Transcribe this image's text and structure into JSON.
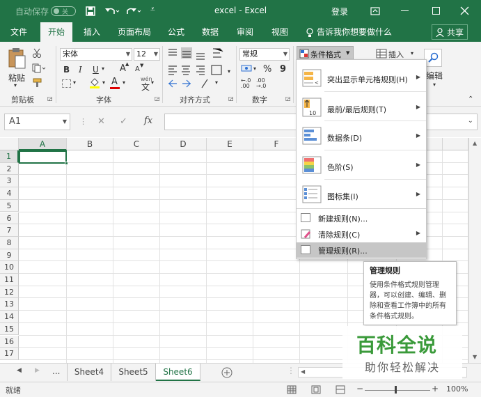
{
  "titlebar": {
    "autosave_label": "自动保存",
    "autosave_state": "关",
    "title": "excel - Excel",
    "login": "登录"
  },
  "tabs": [
    "文件",
    "开始",
    "插入",
    "页面布局",
    "公式",
    "数据",
    "审阅",
    "视图"
  ],
  "tell_me": "告诉我你想要做什么",
  "share": "共享",
  "ribbon": {
    "paste": "粘贴",
    "font_name": "宋体",
    "font_size": "12",
    "bold": "B",
    "italic": "I",
    "underline": "U",
    "grow_font": "A",
    "shrink_font": "A",
    "number_format": "常规",
    "percent": "%",
    "comma": "9",
    "wen": "wén",
    "cond_format": "条件格式",
    "insert": "插入",
    "edit": "编辑",
    "groups": {
      "clipboard": "剪贴板",
      "font": "字体",
      "alignment": "对齐方式",
      "number": "数字"
    }
  },
  "formula_bar": {
    "name_box": "A1",
    "fx": "fx",
    "cancel": "✕",
    "confirm": "✓"
  },
  "grid": {
    "columns": [
      "A",
      "B",
      "C",
      "D",
      "E",
      "F"
    ],
    "rows": [
      "1",
      "2",
      "3",
      "4",
      "5",
      "6",
      "7",
      "8",
      "9",
      "10",
      "11",
      "12",
      "13",
      "14",
      "15",
      "16",
      "17"
    ]
  },
  "menu": {
    "items": [
      {
        "label": "突出显示单元格规则(H)",
        "has_submenu": true
      },
      {
        "label": "最前/最后规则(T)",
        "has_submenu": true
      },
      {
        "label": "数据条(D)",
        "has_submenu": true
      },
      {
        "label": "色阶(S)",
        "has_submenu": true
      },
      {
        "label": "图标集(I)",
        "has_submenu": true
      }
    ],
    "small_items": [
      {
        "label": "新建规则(N)...",
        "has_submenu": false
      },
      {
        "label": "清除规则(C)",
        "has_submenu": true
      },
      {
        "label": "管理规则(R)...",
        "has_submenu": false
      }
    ],
    "icon_10": "10"
  },
  "tooltip": {
    "title": "管理规则",
    "body": "使用条件格式规则管理器，可以创建、编辑、删除和查看工作簿中的所有条件格式规则。"
  },
  "sheets": {
    "tabs": [
      "Sheet4",
      "Sheet5",
      "Sheet6"
    ],
    "active": "Sheet6",
    "more": "..."
  },
  "status": {
    "ready": "就绪",
    "zoom": "100%"
  },
  "watermark": {
    "big": "百科全说",
    "small": "助你轻松解决"
  },
  "colors": {
    "excel_green": "#217346",
    "menu_hover": "#c6c6c6"
  }
}
